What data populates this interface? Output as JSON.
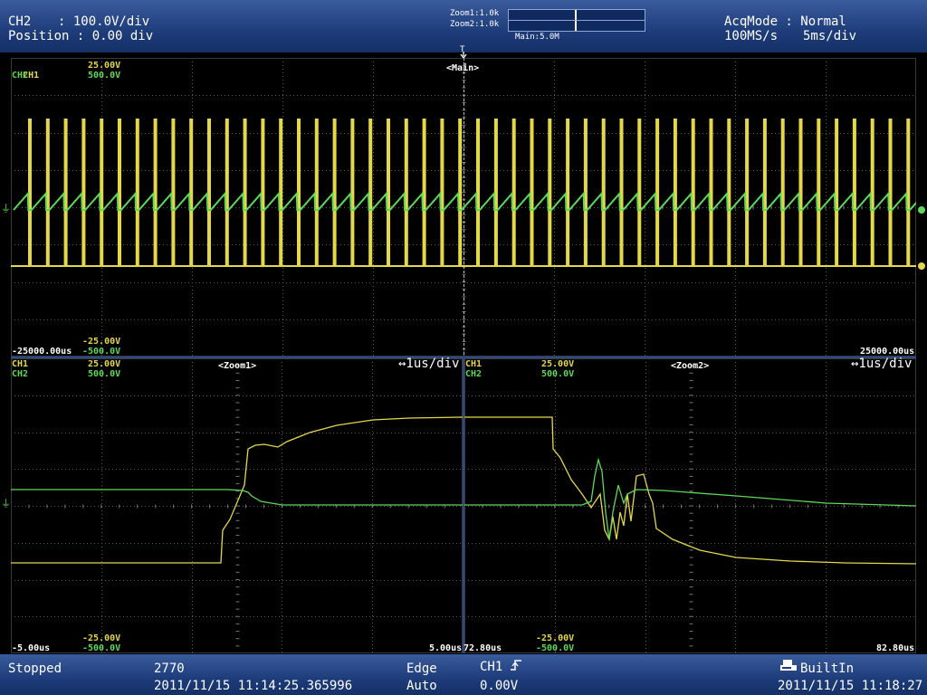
{
  "header": {
    "channel": "CH2",
    "vdiv_sep": ": 100.0V/div",
    "position_label": "Position : 0.00 div",
    "zoom1": "Zoom1:1.0k",
    "zoom2": "Zoom2:1.0k",
    "main_rate": "Main:5.0M",
    "acq_mode": "AcqMode : Normal",
    "sample_rate": "100MS/s",
    "time_div": "5ms/div"
  },
  "main_pane": {
    "title": "<Main>",
    "ch1_label": "CH1",
    "ch1_scale": "25.00V",
    "ch2_label": "CH2",
    "ch2_scale": "500.0V",
    "ch1_bottom": "-25.00V",
    "ch2_bottom": "-500.0V",
    "time_left": "-25000.00us",
    "time_right": "25000.00us"
  },
  "zoom1_pane": {
    "title": "<Zoom1>",
    "timebase": "↔1us/div",
    "ch1_label": "CH1",
    "ch1_scale": "25.00V",
    "ch2_label": "CH2",
    "ch2_scale": "500.0V",
    "ch1_bottom": "-25.00V",
    "ch2_bottom": "-500.0V",
    "time_left": "-5.00us",
    "time_right": "5.00us"
  },
  "zoom2_pane": {
    "title": "<Zoom2>",
    "timebase": "↔1us/div",
    "ch1_label": "CH1",
    "ch1_scale": "25.00V",
    "ch2_label": "CH2",
    "ch2_scale": "500.0V",
    "ch1_bottom": "-25.00V",
    "ch2_bottom": "-500.0V",
    "time_left": "72.80us",
    "time_right": "82.80us"
  },
  "footer": {
    "status": "Stopped",
    "count": "2770",
    "acq_time": "2011/11/15 11:14:25.365996",
    "trigger_type": "Edge",
    "trigger_mode": "Auto",
    "trigger_source": "CH1",
    "trigger_level": "0.00V",
    "storage": "BuiltIn",
    "clock": "2011/11/15 11:18:27"
  },
  "colors": {
    "ch1": "#e4d84a",
    "ch2": "#5ed85a",
    "grid": "#5a5a5a",
    "bar": "#1e3c7a"
  }
}
